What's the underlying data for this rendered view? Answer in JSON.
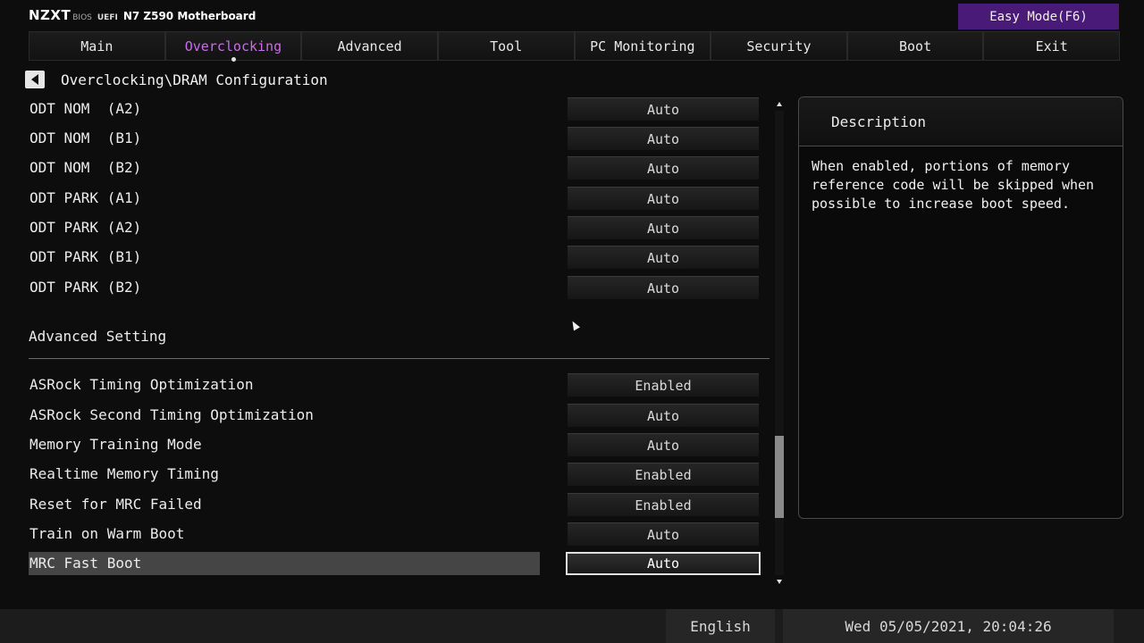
{
  "brand": {
    "name": "NZXT",
    "bios": "BIOS",
    "uefi": "UEFI",
    "model": "N7 Z590 Motherboard"
  },
  "easy_mode": "Easy Mode(F6)",
  "tabs": [
    {
      "label": "Main"
    },
    {
      "label": "Overclocking",
      "active": true
    },
    {
      "label": "Advanced"
    },
    {
      "label": "Tool"
    },
    {
      "label": "PC Monitoring"
    },
    {
      "label": "Security"
    },
    {
      "label": "Boot"
    },
    {
      "label": "Exit"
    }
  ],
  "breadcrumb": "Overclocking\\DRAM Configuration",
  "settings_top": [
    {
      "label": "ODT NOM  (A2)",
      "value": "Auto"
    },
    {
      "label": "ODT NOM  (B1)",
      "value": "Auto"
    },
    {
      "label": "ODT NOM  (B2)",
      "value": "Auto"
    },
    {
      "label": "ODT PARK (A1)",
      "value": "Auto"
    },
    {
      "label": "ODT PARK (A2)",
      "value": "Auto"
    },
    {
      "label": "ODT PARK (B1)",
      "value": "Auto"
    },
    {
      "label": "ODT PARK (B2)",
      "value": "Auto"
    }
  ],
  "section_title": "Advanced Setting",
  "settings_bottom": [
    {
      "label": "ASRock Timing Optimization",
      "value": "Enabled"
    },
    {
      "label": "ASRock Second Timing Optimization",
      "value": "Auto"
    },
    {
      "label": "Memory Training Mode",
      "value": "Auto"
    },
    {
      "label": "Realtime Memory Timing",
      "value": "Enabled"
    },
    {
      "label": "Reset for MRC Failed",
      "value": "Enabled"
    },
    {
      "label": "Train on Warm Boot",
      "value": "Auto"
    },
    {
      "label": "MRC Fast Boot",
      "value": "Auto",
      "selected": true
    }
  ],
  "description": {
    "title": "Description",
    "text": "When enabled, portions of memory reference code will be skipped when possible to increase boot speed."
  },
  "footer": {
    "language": "English",
    "datetime": "Wed 05/05/2021, 20:04:26"
  },
  "colors": {
    "accent": "#c86ee8",
    "easy_mode_bg": "#4a1a78"
  },
  "scroll_position": 0.85
}
